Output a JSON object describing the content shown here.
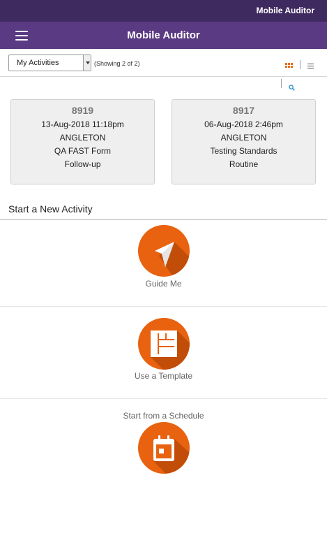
{
  "status_bar": {
    "title": "Mobile Auditor"
  },
  "app_bar": {
    "title": "Mobile Auditor",
    "menu_icon": "hamburger-menu-icon"
  },
  "filter": {
    "selected": "My Activities",
    "showing": "(Showing 2 of 2)"
  },
  "view_icons": {
    "grid": "grid-view-icon",
    "list": "list-view-icon",
    "search": "search-icon"
  },
  "activities": [
    {
      "id": "8919",
      "date": "13-Aug-2018 11:18pm",
      "site": "ANGLETON",
      "form": "QA FAST Form",
      "type": "Follow-up"
    },
    {
      "id": "8917",
      "date": "06-Aug-2018 2:46pm",
      "site": "ANGLETON",
      "form": "Testing Standards",
      "type": "Routine"
    }
  ],
  "new_activity": {
    "title": "Start a New Activity",
    "guide": {
      "label": "Guide Me",
      "icon": "paper-plane-icon"
    },
    "template": {
      "label": "Use a Template",
      "icon": "template-layout-icon"
    },
    "schedule": {
      "label": "Start from a Schedule",
      "icon": "calendar-icon"
    }
  },
  "colors": {
    "status_bar": "#3f2a60",
    "app_bar": "#5a3a82",
    "accent": "#e8620f",
    "card_bg": "#efefef"
  }
}
